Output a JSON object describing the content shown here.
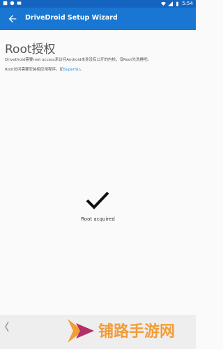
{
  "status_bar": {
    "time": "5:54",
    "left_icons": [
      "notification-icon-1",
      "notification-icon-2",
      "notification-icon-3"
    ]
  },
  "appbar": {
    "title": "DriveDroid Setup Wizard"
  },
  "page": {
    "heading": "Root授权",
    "description": "DriveDroid需要root access来访问Android本身没有公开的内核，没Root先洗睡吧。",
    "note_prefix": "Root访问需要安装相应用程序，如",
    "note_link": "SuperSU",
    "note_suffix": "。",
    "status_text": "Root acquired"
  },
  "watermark": {
    "text": "铺路手游网"
  },
  "colors": {
    "appbar": "#1976d2",
    "statusbar": "#1565c0",
    "link": "#1e88e5",
    "watermark": "#f29c38"
  }
}
